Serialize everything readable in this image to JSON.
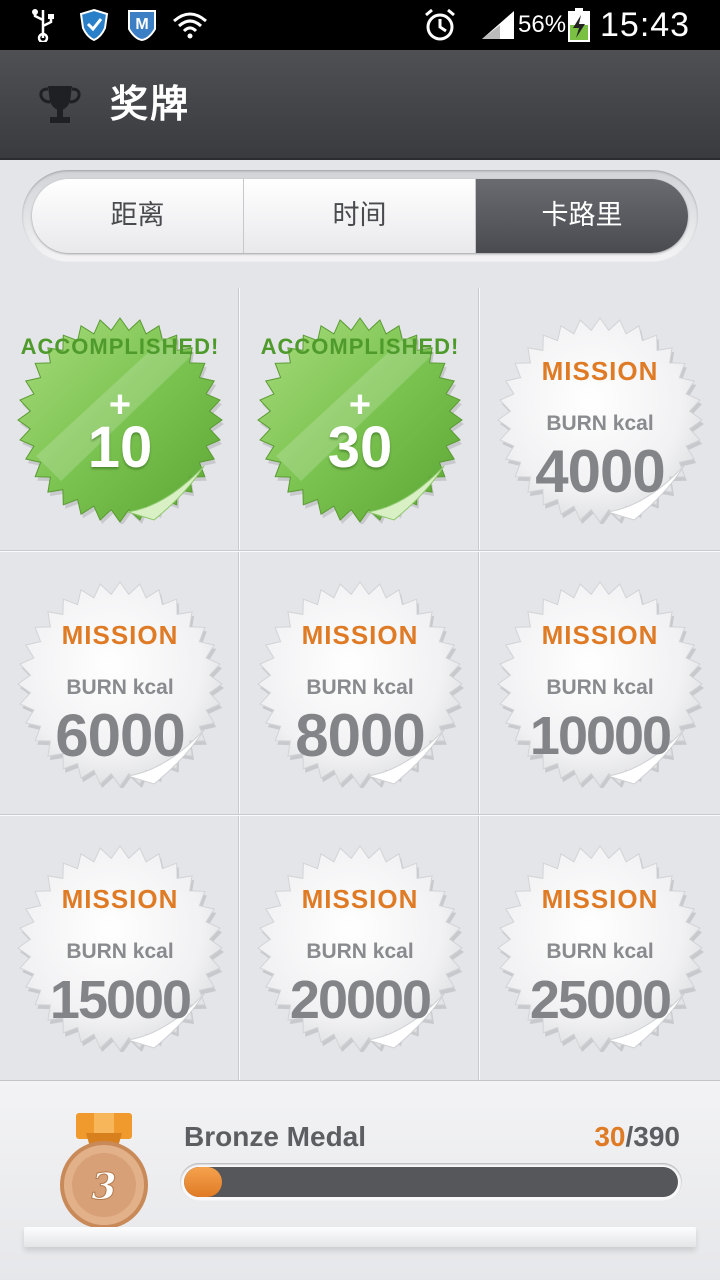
{
  "status_bar": {
    "icons": [
      "usb-icon",
      "shield-icon",
      "m-app-icon",
      "wifi-question-icon",
      "alarm-icon",
      "signal-icon",
      "battery-charging-icon"
    ],
    "battery": "56%",
    "time": "15:43"
  },
  "header": {
    "title": "奖牌",
    "icon": "trophy-icon"
  },
  "tabs": [
    {
      "label": "距离",
      "active": false
    },
    {
      "label": "时间",
      "active": false
    },
    {
      "label": "卡路里",
      "active": true
    }
  ],
  "badges": [
    {
      "status": "accomplished",
      "banner": "ACCOMPLISHED!",
      "plus": "+",
      "value": "10"
    },
    {
      "status": "accomplished",
      "banner": "ACCOMPLISHED!",
      "plus": "+",
      "value": "30"
    },
    {
      "status": "mission",
      "banner": "MISSION",
      "label": "BURN kcal",
      "value": "4000"
    },
    {
      "status": "mission",
      "banner": "MISSION",
      "label": "BURN kcal",
      "value": "6000"
    },
    {
      "status": "mission",
      "banner": "MISSION",
      "label": "BURN kcal",
      "value": "8000"
    },
    {
      "status": "mission",
      "banner": "MISSION",
      "label": "BURN kcal",
      "value": "10000"
    },
    {
      "status": "mission",
      "banner": "MISSION",
      "label": "BURN kcal",
      "value": "15000"
    },
    {
      "status": "mission",
      "banner": "MISSION",
      "label": "BURN kcal",
      "value": "20000"
    },
    {
      "status": "mission",
      "banner": "MISSION",
      "label": "BURN kcal",
      "value": "25000"
    }
  ],
  "medal": {
    "icon": "bronze-medal-icon",
    "rank": "3",
    "name": "Bronze Medal",
    "current": "30",
    "separator": "/",
    "total": "390",
    "progress_fraction": 0.077
  },
  "colors": {
    "accent_orange": "#e07b25",
    "accomplished_green": "#7cc451",
    "header_bg": "#45464a",
    "active_tab": "#5a5b60"
  }
}
